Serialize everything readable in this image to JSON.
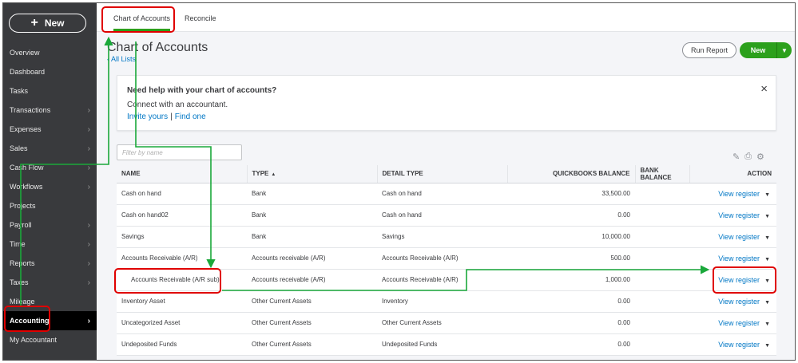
{
  "sidebar": {
    "new_label": "New",
    "items": [
      {
        "label": "Overview",
        "chevron": false
      },
      {
        "label": "Dashboard",
        "chevron": false
      },
      {
        "label": "Tasks",
        "chevron": false
      },
      {
        "label": "Transactions",
        "chevron": true
      },
      {
        "label": "Expenses",
        "chevron": true
      },
      {
        "label": "Sales",
        "chevron": true
      },
      {
        "label": "Cash Flow",
        "chevron": true
      },
      {
        "label": "Workflows",
        "chevron": true
      },
      {
        "label": "Projects",
        "chevron": false
      },
      {
        "label": "Payroll",
        "chevron": true
      },
      {
        "label": "Time",
        "chevron": true
      },
      {
        "label": "Reports",
        "chevron": true
      },
      {
        "label": "Taxes",
        "chevron": true
      },
      {
        "label": "Mileage",
        "chevron": false
      },
      {
        "label": "Accounting",
        "chevron": true,
        "active": true
      },
      {
        "label": "My Accountant",
        "chevron": false
      }
    ]
  },
  "tabs": [
    {
      "label": "Chart of Accounts",
      "active": true
    },
    {
      "label": "Reconcile",
      "active": false
    }
  ],
  "header": {
    "title": "Chart of Accounts",
    "back_link": "All Lists",
    "run_report": "Run Report",
    "new_label": "New"
  },
  "help_card": {
    "title": "Need help with your chart of accounts?",
    "subtitle": "Connect with an accountant.",
    "link_invite": "Invite yours",
    "link_find": "Find one",
    "close": "×"
  },
  "filter": {
    "placeholder": "Filter by name"
  },
  "table": {
    "columns": [
      "NAME",
      "TYPE",
      "DETAIL TYPE",
      "QUICKBOOKS BALANCE",
      "BANK BALANCE",
      "ACTION"
    ],
    "action_label": "View register",
    "rows": [
      {
        "name": "Cash on hand",
        "type": "Bank",
        "detail": "Cash on hand",
        "qb_balance": "33,500.00",
        "bank_balance": ""
      },
      {
        "name": "Cash on hand02",
        "type": "Bank",
        "detail": "Cash on hand",
        "qb_balance": "0.00",
        "bank_balance": ""
      },
      {
        "name": "Savings",
        "type": "Bank",
        "detail": "Savings",
        "qb_balance": "10,000.00",
        "bank_balance": ""
      },
      {
        "name": "Accounts Receivable (A/R)",
        "type": "Accounts receivable (A/R)",
        "detail": "Accounts Receivable (A/R)",
        "qb_balance": "500.00",
        "bank_balance": ""
      },
      {
        "name": "Accounts Receivable (A/R sub)",
        "type": "Accounts receivable (A/R)",
        "detail": "Accounts Receivable (A/R)",
        "qb_balance": "1,000.00",
        "bank_balance": "",
        "sub": true
      },
      {
        "name": "Inventory Asset",
        "type": "Other Current Assets",
        "detail": "Inventory",
        "qb_balance": "0.00",
        "bank_balance": ""
      },
      {
        "name": "Uncategorized Asset",
        "type": "Other Current Assets",
        "detail": "Other Current Assets",
        "qb_balance": "0.00",
        "bank_balance": ""
      },
      {
        "name": "Undeposited Funds",
        "type": "Other Current Assets",
        "detail": "Undeposited Funds",
        "qb_balance": "0.00",
        "bank_balance": ""
      }
    ]
  },
  "colors": {
    "brand_green": "#2ca01c",
    "link_blue": "#0077c5",
    "sidebar_bg": "#393a3d",
    "annotation_red": "#e00000",
    "annotation_green": "#1aa83a"
  },
  "icons": [
    "plus-icon",
    "chevron-right-icon",
    "close-icon",
    "pencil-icon",
    "print-icon",
    "gear-icon",
    "caret-down-icon",
    "sort-up-icon"
  ]
}
